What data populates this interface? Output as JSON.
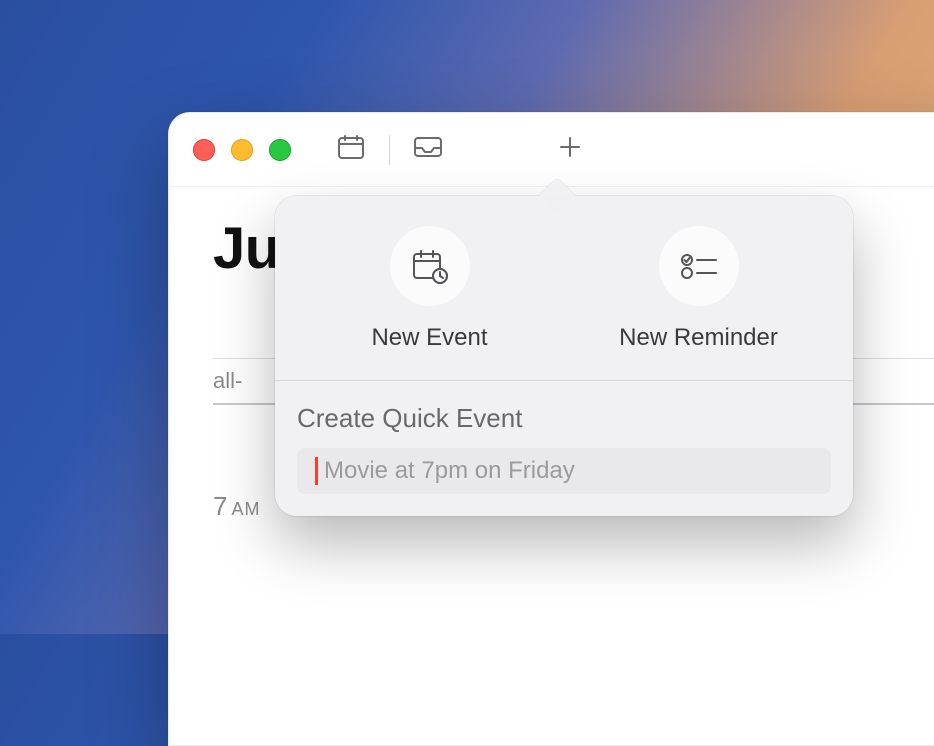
{
  "titlebar": {
    "close_name": "close",
    "minimize_name": "minimize",
    "zoom_name": "zoom"
  },
  "header": {
    "month_partial": "Ju"
  },
  "allday": {
    "label_partial": "all-"
  },
  "hours": {
    "hour": "7",
    "ampm": "AM"
  },
  "popover": {
    "new_event_label": "New Event",
    "new_reminder_label": "New Reminder",
    "quick_title": "Create Quick Event",
    "quick_placeholder": "Movie at 7pm on Friday",
    "quick_value": ""
  }
}
